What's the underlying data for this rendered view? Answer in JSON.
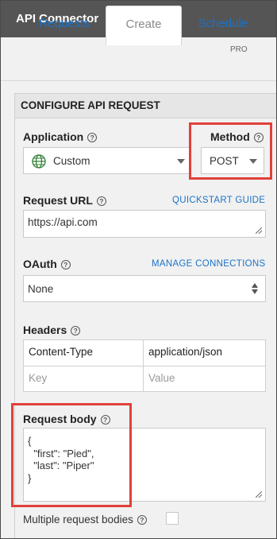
{
  "app": {
    "title": "API Connector"
  },
  "tabs": [
    {
      "label": "Requests"
    },
    {
      "label": "Create"
    },
    {
      "label": "Schedule"
    }
  ],
  "badge": {
    "pro": "PRO"
  },
  "panel": {
    "title": "CONFIGURE API REQUEST"
  },
  "application": {
    "label": "Application",
    "value": "Custom",
    "icon": "globe-icon"
  },
  "method": {
    "label": "Method",
    "value": "POST"
  },
  "request_url": {
    "label": "Request URL",
    "link": "QUICKSTART GUIDE",
    "value": "https://api.com"
  },
  "oauth": {
    "label": "OAuth",
    "link": "MANAGE CONNECTIONS",
    "value": "None"
  },
  "headers": {
    "label": "Headers",
    "rows": [
      {
        "key": "Content-Type",
        "value": "application/json"
      },
      {
        "key_placeholder": "Key",
        "value_placeholder": "Value"
      }
    ]
  },
  "body": {
    "label": "Request body",
    "lines": [
      "{",
      "  \"first\": \"Pied\",",
      "  \"last\": \"Piper\"",
      "}"
    ]
  },
  "multiple": {
    "label": "Multiple request bodies"
  },
  "help_glyph": "?",
  "colors": {
    "titlebar": "#555555",
    "link": "#1a73c8",
    "highlight": "#e0413a"
  }
}
